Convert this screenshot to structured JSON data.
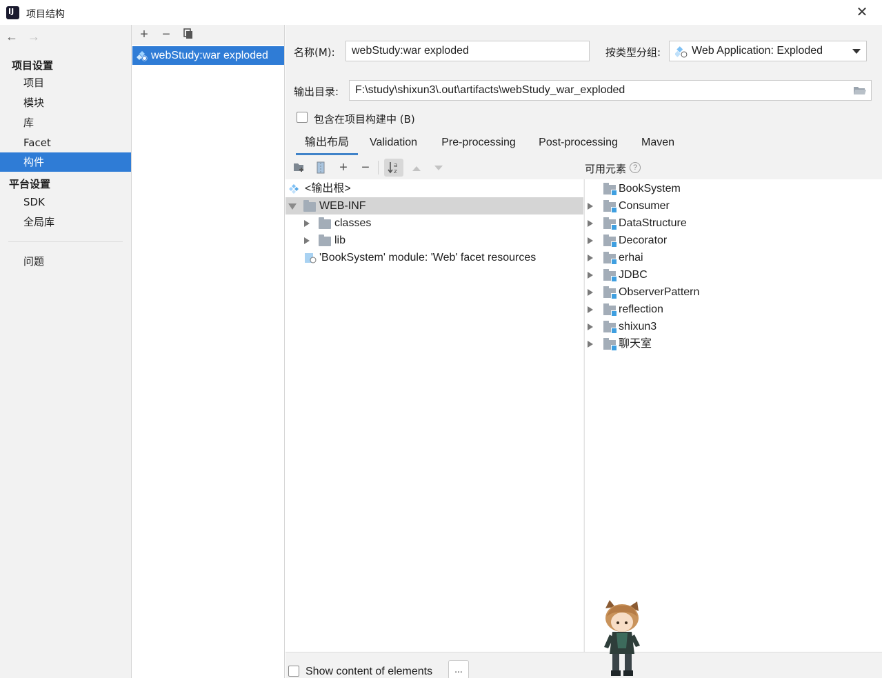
{
  "window": {
    "title": "项目结构",
    "close_symbol": "✕"
  },
  "sidebar": {
    "back_symbol": "←",
    "forward_symbol": "→",
    "section_project": "项目设置",
    "project_items": [
      "项目",
      "模块",
      "库",
      "Facet",
      "构件"
    ],
    "selected_item": "构件",
    "section_platform": "平台设置",
    "platform_items": [
      "SDK",
      "全局库"
    ],
    "problems": "问题"
  },
  "artifacts": {
    "toolbar": {
      "add": "+",
      "remove": "−",
      "copy": "copy-icon"
    },
    "items": [
      "webStudy:war exploded"
    ]
  },
  "form": {
    "name_label": "名称(M):",
    "name_value": "webStudy:war exploded",
    "type_label": "按类型分组:",
    "type_value": "Web Application: Exploded",
    "output_label": "输出目录:",
    "output_value": "F:\\study\\shixun3\\.out\\artifacts\\webStudy_war_exploded",
    "include_build_label": "包含在项目构建中 (B)",
    "include_build_checked": false
  },
  "tabs": [
    "输出布局",
    "Validation",
    "Pre-processing",
    "Post-processing",
    "Maven"
  ],
  "active_tab": "输出布局",
  "layout_tree": {
    "root": "<输出根>",
    "webinf": "WEB-INF",
    "classes": "classes",
    "lib": "lib",
    "facet": "'BookSystem' module: 'Web' facet resources"
  },
  "available": {
    "header": "可用元素",
    "help": "?",
    "items": [
      "BookSystem",
      "Consumer",
      "DataStructure",
      "Decorator",
      "erhai",
      "JDBC",
      "ObserverPattern",
      "reflection",
      "shixun3",
      "聊天室"
    ]
  },
  "bottom": {
    "show_content_label": "Show content of elements",
    "show_content_checked": false,
    "more_button": "..."
  },
  "colors": {
    "selection": "#2f7cd6",
    "panel": "#f2f2f2",
    "tab_underline": "#4083c9"
  }
}
